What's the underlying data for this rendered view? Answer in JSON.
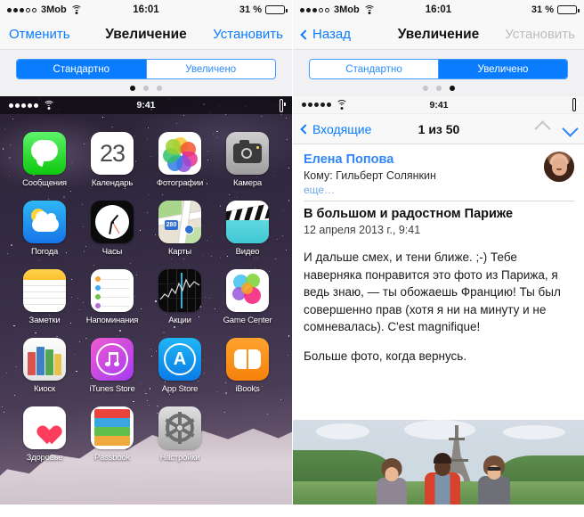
{
  "left_panel": {
    "status_bar": {
      "carrier": "3Mob",
      "time": "16:01",
      "battery_percent": "31 %",
      "signal_filled": 3,
      "signal_total": 5,
      "wifi_icon": "wifi-icon",
      "battery_icon": "battery-icon"
    },
    "navbar": {
      "left_label": "Отменить",
      "title": "Увеличение",
      "right_label": "Установить",
      "right_disabled": false
    },
    "segmented": {
      "options": [
        "Стандартно",
        "Увеличено"
      ],
      "active_index": 0
    },
    "page_dots": {
      "count": 3,
      "active_index": 0
    },
    "device_status": {
      "time": "9:41",
      "signal_filled": 5,
      "wifi_icon": "wifi-icon",
      "battery_icon": "battery-icon"
    },
    "home_screen": {
      "apps": [
        {
          "label": "Сообщения",
          "icon": "messages-icon"
        },
        {
          "label": "Календарь",
          "icon": "calendar-icon",
          "day": "23"
        },
        {
          "label": "Фотографии",
          "icon": "photos-icon"
        },
        {
          "label": "Камера",
          "icon": "camera-icon"
        },
        {
          "label": "Погода",
          "icon": "weather-icon"
        },
        {
          "label": "Часы",
          "icon": "clock-icon"
        },
        {
          "label": "Карты",
          "icon": "maps-icon",
          "shield": "280"
        },
        {
          "label": "Видео",
          "icon": "videos-icon"
        },
        {
          "label": "Заметки",
          "icon": "notes-icon"
        },
        {
          "label": "Напоминания",
          "icon": "reminders-icon"
        },
        {
          "label": "Акции",
          "icon": "stocks-icon"
        },
        {
          "label": "Game Center",
          "icon": "game-center-icon"
        },
        {
          "label": "Киоск",
          "icon": "newsstand-icon"
        },
        {
          "label": "iTunes Store",
          "icon": "itunes-store-icon"
        },
        {
          "label": "App Store",
          "icon": "app-store-icon",
          "glyph": "A"
        },
        {
          "label": "iBooks",
          "icon": "ibooks-icon"
        },
        {
          "label": "Здоровье",
          "icon": "health-icon"
        },
        {
          "label": "Passbook",
          "icon": "passbook-icon"
        },
        {
          "label": "Настройки",
          "icon": "settings-icon"
        }
      ]
    }
  },
  "right_panel": {
    "status_bar": {
      "carrier": "3Mob",
      "time": "16:01",
      "battery_percent": "31 %",
      "signal_filled": 3,
      "signal_total": 5,
      "wifi_icon": "wifi-icon",
      "battery_icon": "battery-icon"
    },
    "navbar": {
      "left_label": "Назад",
      "title": "Увеличение",
      "right_label": "Установить",
      "right_disabled": true
    },
    "segmented": {
      "options": [
        "Стандартно",
        "Увеличено"
      ],
      "active_index": 1
    },
    "page_dots": {
      "count": 3,
      "active_index": 2
    },
    "device_status": {
      "time": "9:41",
      "signal_filled": 5,
      "wifi_icon": "wifi-icon",
      "battery_icon": "battery-icon"
    },
    "mail": {
      "back_label": "Входящие",
      "counter": "1 из 50",
      "up_icon": "chevron-up-icon",
      "down_icon": "chevron-down-icon",
      "sender": "Елена Попова",
      "recipient": "Кому: Гильберт Солянкин",
      "more_label": "еще…",
      "subject": "В большом и радостном Париже",
      "date": "12 апреля 2013 г., 9:41",
      "avatar_name": "sender-avatar",
      "body_paragraphs": [
        "И дальше смех, и тени ближе. ;-) Тебе наверняка понравится это фото из Парижа, я ведь знаю, — ты обожаешь Францию! Ты был совершенно прав (хотя я ни на минуту и не сомневалась). C'est magnifique!",
        "Больше фото, когда вернусь."
      ],
      "attachment_alt": "Фото: три девушки у Эйфелевой башни"
    }
  },
  "colors": {
    "accent_blue": "#0a7cff",
    "disabled_grey": "#bcbcbc",
    "bar_bg": "#f8f8f8",
    "seg_bg": "#f1f1f3"
  }
}
